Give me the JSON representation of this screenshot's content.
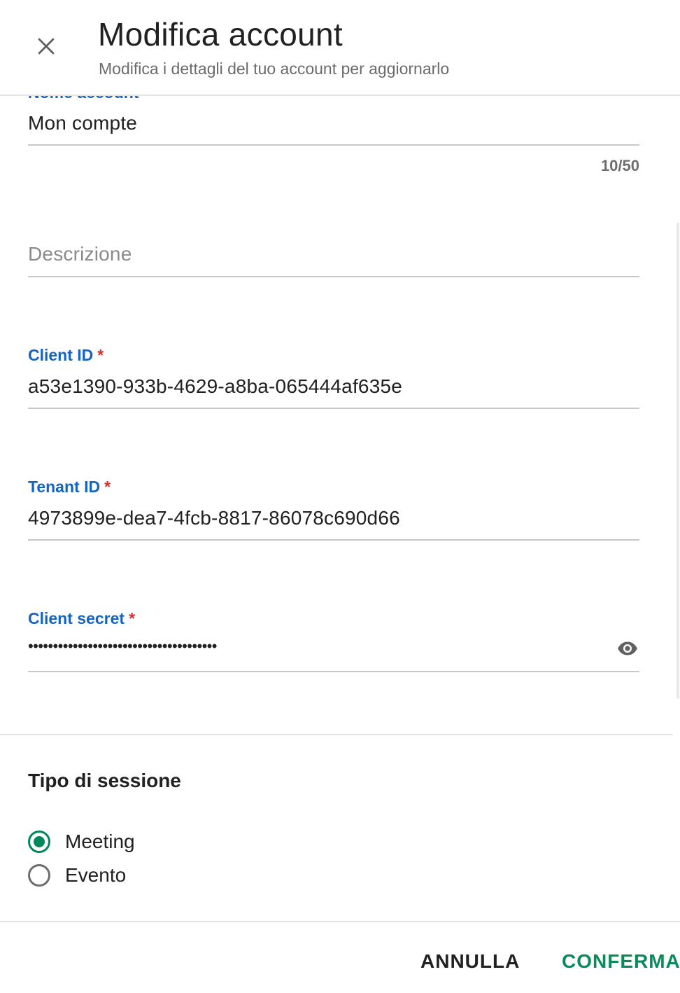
{
  "header": {
    "title": "Modifica account",
    "subtitle": "Modifica i dettagli del tuo account per aggiornarlo"
  },
  "form": {
    "account_name": {
      "label": "Nome account",
      "value": "Mon compte",
      "counter": "10/50"
    },
    "description": {
      "placeholder": "Descrizione",
      "value": ""
    },
    "client_id": {
      "label": "Client ID",
      "required_mark": "*",
      "value": "a53e1390-933b-4629-a8ba-065444af635e"
    },
    "tenant_id": {
      "label": "Tenant ID",
      "required_mark": "*",
      "value": "4973899e-dea7-4fcb-8817-86078c690d66"
    },
    "client_secret": {
      "label": "Client secret",
      "required_mark": "*",
      "value": "••••••••••••••••••••••••••••••••••••••",
      "toggle_icon": "eye-icon"
    }
  },
  "session_type": {
    "title": "Tipo di sessione",
    "options": [
      {
        "label": "Meeting",
        "selected": true
      },
      {
        "label": "Evento",
        "selected": false
      }
    ]
  },
  "footer": {
    "cancel_label": "ANNULLA",
    "confirm_label": "CONFERMA"
  },
  "colors": {
    "label_blue": "#1565c0",
    "required_red": "#d32f2f",
    "accent_green": "#00875a",
    "confirm_green": "#0b8a5c"
  }
}
